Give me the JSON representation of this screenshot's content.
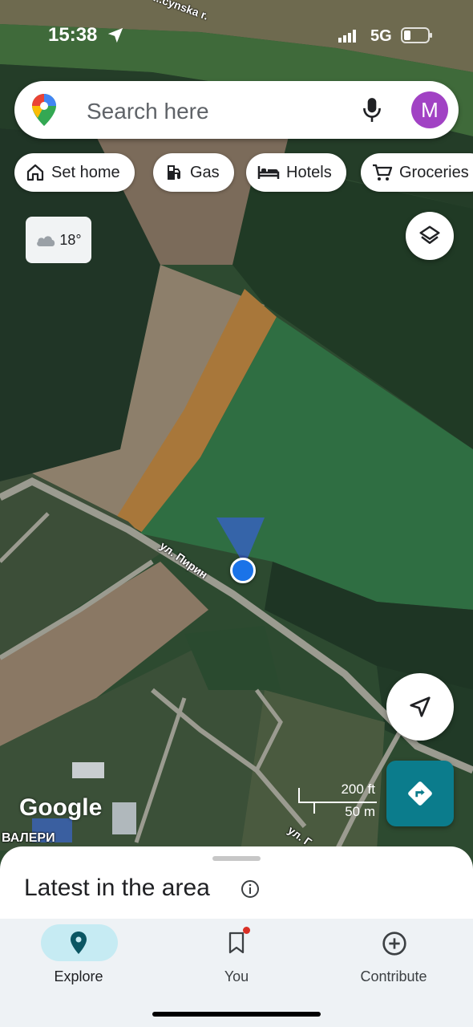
{
  "status_bar": {
    "time": "15:38",
    "network": "5G"
  },
  "search": {
    "placeholder": "Search here",
    "avatar_letter": "M"
  },
  "chips": [
    {
      "label": "Set home",
      "icon": "home-icon"
    },
    {
      "label": "Gas",
      "icon": "gas-station-icon"
    },
    {
      "label": "Hotels",
      "icon": "bed-icon"
    },
    {
      "label": "Groceries",
      "icon": "cart-icon"
    }
  ],
  "weather": {
    "temperature": "18°",
    "icon": "cloud-icon"
  },
  "map": {
    "river_label": "...cynska r.",
    "street_labels": [
      "ул. Пирин",
      "ул. Г",
      "ВАЛЕРИ"
    ],
    "scale": {
      "feet": "200 ft",
      "meters": "50 m"
    },
    "attribution": "Google",
    "colors": {
      "location_dot": "#1a73e8",
      "directions_button": "#0b7c8c"
    }
  },
  "sheet": {
    "title": "Latest in the area"
  },
  "nav": {
    "items": [
      {
        "label": "Explore",
        "icon": "pin-icon",
        "active": true
      },
      {
        "label": "You",
        "icon": "bookmark-icon",
        "has_badge": true
      },
      {
        "label": "Contribute",
        "icon": "add-circle-icon"
      }
    ]
  }
}
